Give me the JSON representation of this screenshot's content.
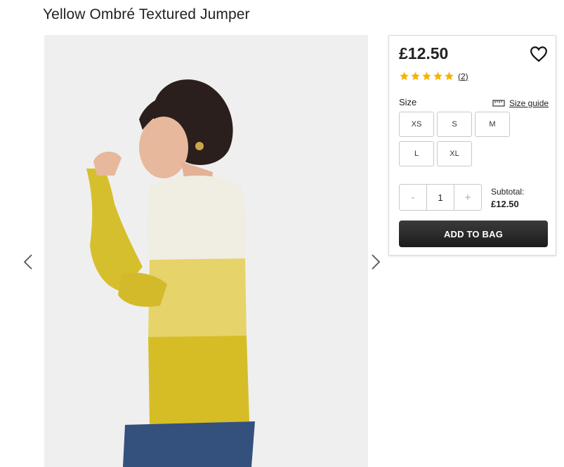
{
  "product": {
    "title": "Yellow Ombré Textured Jumper",
    "price": "£12.50",
    "rating": 5,
    "review_count": "(2)"
  },
  "size": {
    "label": "Size",
    "guide_label": "Size guide",
    "options": [
      "XS",
      "S",
      "M",
      "L",
      "XL"
    ]
  },
  "quantity": {
    "minus": "-",
    "value": "1",
    "plus": "+"
  },
  "subtotal": {
    "label": "Subtotal:",
    "amount": "£12.50"
  },
  "actions": {
    "add_to_bag": "ADD TO BAG"
  },
  "icons": {
    "wishlist": "heart-icon",
    "rating": "star-icon",
    "size_guide": "ruler-icon",
    "prev": "chevron-left-icon",
    "next": "chevron-right-icon"
  },
  "colors": {
    "star": "#f5b301",
    "button": "#222222",
    "jumper_yellow": "#d8c12c",
    "jumper_cream": "#f2efe6",
    "jeans": "#35507a"
  }
}
